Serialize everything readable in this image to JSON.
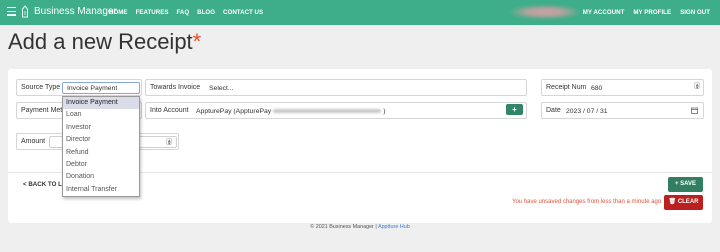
{
  "nav": {
    "brand": "Business Manager",
    "links": [
      "HOME",
      "FEATURES",
      "FAQ",
      "BLOG",
      "CONTACT US"
    ],
    "right_links": [
      "MY ACCOUNT",
      "MY PROFILE",
      "SIGN OUT"
    ]
  },
  "page": {
    "title": "Add a new Receipt",
    "required_mark": "*"
  },
  "form": {
    "source_type": {
      "label": "Source Type",
      "value": "Invoice Payment"
    },
    "towards_invoice": {
      "label": "Towards Invoice",
      "value": "Select..."
    },
    "receipt_num": {
      "label": "Receipt Num",
      "value": "680"
    },
    "payment_method": {
      "label": "Payment Met"
    },
    "into_account": {
      "label": "Into Account",
      "value_prefix": "AppturePay (AppturePay",
      "value_suffix": ")"
    },
    "date": {
      "label": "Date",
      "value": "2023 / 07 / 31"
    },
    "amount": {
      "label": "Amount"
    }
  },
  "source_type_options": [
    "Invoice Payment",
    "Loan",
    "Investor",
    "Director",
    "Refund",
    "Debtor",
    "Donation",
    "Internal Transfer"
  ],
  "actions": {
    "back": "< BACK TO LIS",
    "save": "+ SAVE",
    "clear": "CLEAR",
    "unsaved_message": "You have unsaved changes from less than a minute ago"
  },
  "footer": {
    "text": "© 2021 Business Manager | ",
    "link": "Apptture Hub"
  },
  "colors": {
    "nav_bg": "#3dae89",
    "save_bg": "#317e62",
    "clear_bg": "#bb2020",
    "required": "#e84b2a",
    "warning_text": "#e0533a"
  }
}
